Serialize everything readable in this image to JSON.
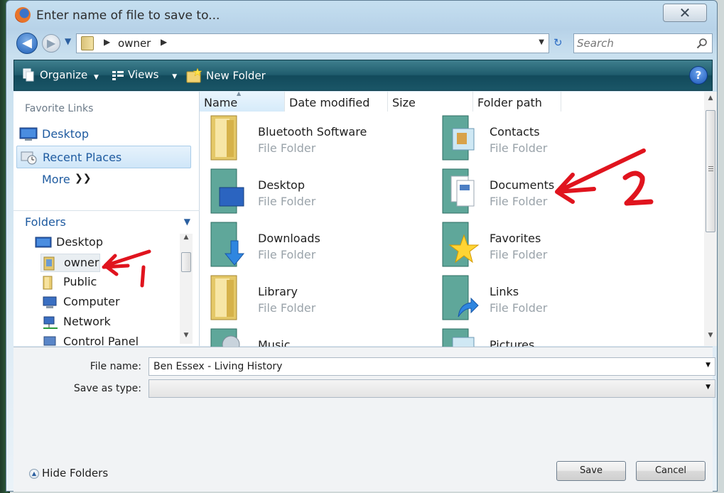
{
  "window": {
    "title": "Enter name of file to save to...",
    "close_glyph": "✕"
  },
  "address": {
    "path": "owner",
    "search_placeholder": "Search"
  },
  "toolbar": {
    "organize_label": "Organize",
    "views_label": "Views",
    "new_folder_label": "New Folder",
    "help_glyph": "?"
  },
  "favorites": {
    "header": "Favorite Links",
    "items": [
      {
        "label": "Desktop",
        "icon": "desktop-icon"
      },
      {
        "label": "Recent Places",
        "icon": "recent-places-icon"
      }
    ],
    "more_label": "More"
  },
  "folders": {
    "header": "Folders",
    "tree": [
      {
        "label": "Desktop",
        "icon": "desktop-icon"
      },
      {
        "label": "owner",
        "icon": "user-folder-icon"
      },
      {
        "label": "Public",
        "icon": "folder-icon"
      },
      {
        "label": "Computer",
        "icon": "computer-icon"
      },
      {
        "label": "Network",
        "icon": "network-icon"
      },
      {
        "label": "Control Panel",
        "icon": "control-panel-icon"
      }
    ]
  },
  "columns": [
    "Name",
    "Date modified",
    "Size",
    "Folder path"
  ],
  "files": [
    {
      "name": "Bluetooth Software",
      "type": "File Folder",
      "icon": "folder-icon"
    },
    {
      "name": "Contacts",
      "type": "File Folder",
      "icon": "contacts-folder-icon"
    },
    {
      "name": "Desktop",
      "type": "File Folder",
      "icon": "desktop-folder-icon"
    },
    {
      "name": "Documents",
      "type": "File Folder",
      "icon": "documents-folder-icon"
    },
    {
      "name": "Downloads",
      "type": "File Folder",
      "icon": "downloads-folder-icon"
    },
    {
      "name": "Favorites",
      "type": "File Folder",
      "icon": "favorites-folder-icon"
    },
    {
      "name": "Library",
      "type": "File Folder",
      "icon": "folder-icon"
    },
    {
      "name": "Links",
      "type": "File Folder",
      "icon": "links-folder-icon"
    },
    {
      "name": "Music",
      "type": "",
      "icon": "music-folder-icon"
    },
    {
      "name": "Pictures",
      "type": "",
      "icon": "pictures-folder-icon"
    }
  ],
  "form": {
    "file_name_label": "File name:",
    "file_name_value": "Ben Essex - Living History",
    "save_type_label": "Save as type:",
    "save_type_value": ""
  },
  "footer": {
    "hide_folders_label": "Hide Folders",
    "save_label": "Save",
    "cancel_label": "Cancel"
  },
  "annotations": {
    "arrow1_label": "1",
    "arrow2_label": "2",
    "color": "#e0141e"
  },
  "colors": {
    "toolbar": "#1f5c6d",
    "link": "#1f5ba0",
    "selection": "#cfe6f8"
  }
}
